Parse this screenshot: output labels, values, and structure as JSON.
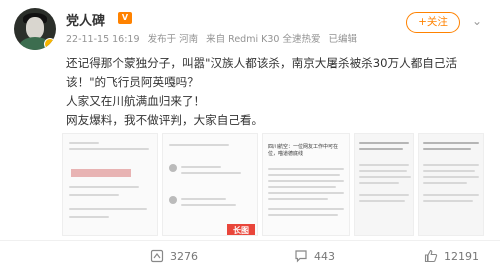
{
  "post": {
    "username": "党人碑",
    "vip_badge": "V",
    "timestamp": "22-11-15 16:19",
    "source": "发布于 河南",
    "device": "来自 Redmi K30 全速热爱",
    "edited": "已编辑",
    "follow_label": "+关注",
    "more_label": "⌄",
    "text_lines": [
      "还记得那个蒙独分子，叫嚣\"汉族人都该杀，南京大屠杀被杀30万人都自己活",
      "该！\"的飞行员阿英嘎吗？",
      "人家又在川航满血归来了！",
      "网友爆料，我不做评判，大家自己看。"
    ],
    "images": {
      "long_image_tag": "长图",
      "doc_title": "四川航空：一位网友工作中可在位，喵道德底线"
    }
  },
  "actions": {
    "repost_count": "3276",
    "comment_count": "443",
    "like_count": "12191"
  },
  "colors": {
    "accent": "#ff8200",
    "long_tag": "#e9463b",
    "text": "#333333",
    "meta": "#939393"
  }
}
